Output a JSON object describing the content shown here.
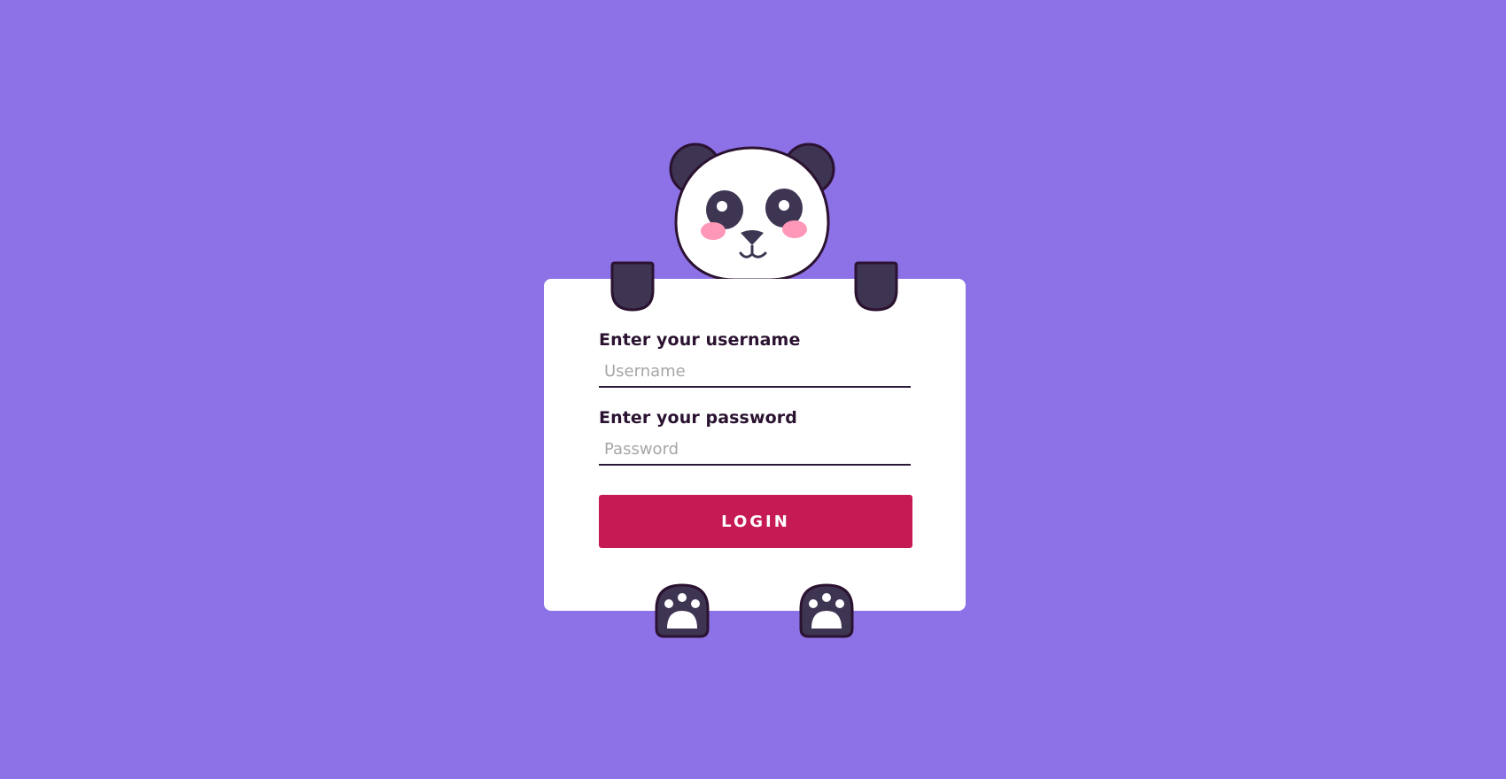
{
  "colors": {
    "background": "#8c72e6",
    "card": "#ffffff",
    "accent_button": "#c51a54",
    "panda_dark": "#3e3553",
    "panda_outline": "#2a1230",
    "blush": "#ff97b8"
  },
  "form": {
    "username_label": "Enter your username",
    "username_placeholder": "Username",
    "username_value": "",
    "password_label": "Enter your password",
    "password_placeholder": "Password",
    "password_value": "",
    "login_label": "LOGIN"
  },
  "icons": {
    "mascot": "panda-head-icon",
    "hands": "panda-hand-icon",
    "paws": "panda-paw-icon"
  }
}
